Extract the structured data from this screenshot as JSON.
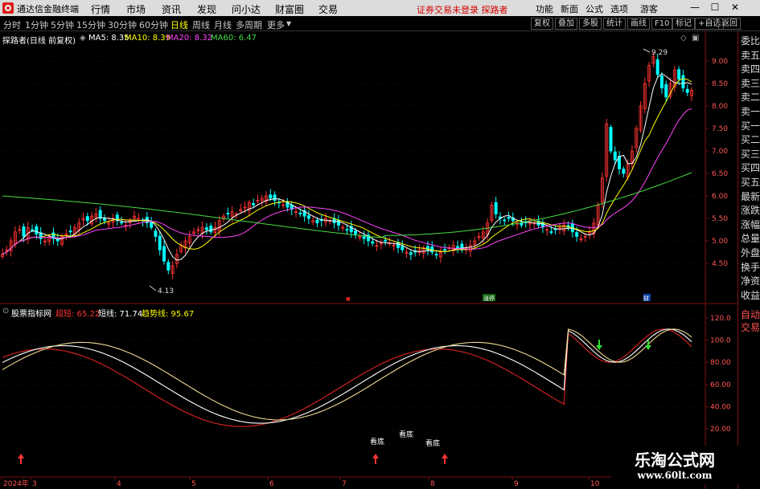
{
  "menubar": {
    "app_title": "通达信金融终端",
    "items": [
      "行情",
      "市场",
      "资讯",
      "发现",
      "问小达",
      "财富圈",
      "交易"
    ],
    "warning": "证券交易未登录  探路者",
    "right_items": [
      "功能",
      "新面",
      "公式",
      "选项",
      "游客"
    ],
    "win_buttons": [
      "—",
      "☐",
      "✕"
    ]
  },
  "toolbar": {
    "periods": [
      "分时",
      "1分钟",
      "5分钟",
      "15分钟",
      "30分钟",
      "60分钟",
      "日线",
      "周线",
      "月线",
      "多周期",
      "更多"
    ],
    "active_period": "日线",
    "buttons": [
      "复权",
      "叠加",
      "多股",
      "统计",
      "画线",
      "F10",
      "标记",
      "+自选",
      "返回"
    ]
  },
  "price_header": {
    "name": "探路者(日线 前复权)",
    "ma5": "MA5: 8.35",
    "ma10": "MA10: 8.39",
    "ma20": "MA20: 8.32",
    "ma60": "MA60: 6.47"
  },
  "indicator_header": {
    "name": "股票指标网",
    "line1": "超短: 65.22",
    "line2": "短线: 71.74",
    "line3": "趋势线: 95.67"
  },
  "right_panel": {
    "top": [
      "委比",
      "卖五",
      "卖四",
      "卖三",
      "卖二",
      "卖一",
      "买一",
      "买二",
      "买三",
      "买四",
      "买五",
      "最新",
      "涨跌",
      "涨幅",
      "总量",
      "外盘",
      "换手",
      "净资",
      "收益"
    ],
    "bottom": [
      "自动",
      "交易"
    ]
  },
  "axes": {
    "price_ticks": [
      "9.00",
      "8.50",
      "8.00",
      "7.50",
      "7.00",
      "6.50",
      "6.00",
      "5.50",
      "5.00",
      "4.50"
    ],
    "indicator_ticks": [
      "120.0",
      "100.0",
      "80.00",
      "60.00",
      "40.00",
      "20.00"
    ],
    "x_labels": [
      "2024年",
      "3",
      "4",
      "5",
      "6",
      "7",
      "8",
      "9",
      "10"
    ]
  },
  "annotations": {
    "high": "9.29",
    "low": "4.13",
    "bottom_labels": [
      "看底",
      "看底",
      "看底"
    ],
    "markers": [
      "涨停",
      "财"
    ]
  },
  "watermark": {
    "line1": "乐淘公式网",
    "line2": "www.60lt.com"
  },
  "colors": {
    "up": "#ff3333",
    "down": "#00ffff",
    "ma5": "#ffffff",
    "ma10": "#ffff00",
    "ma20": "#ff44ff",
    "ma60": "#44dd44"
  }
}
